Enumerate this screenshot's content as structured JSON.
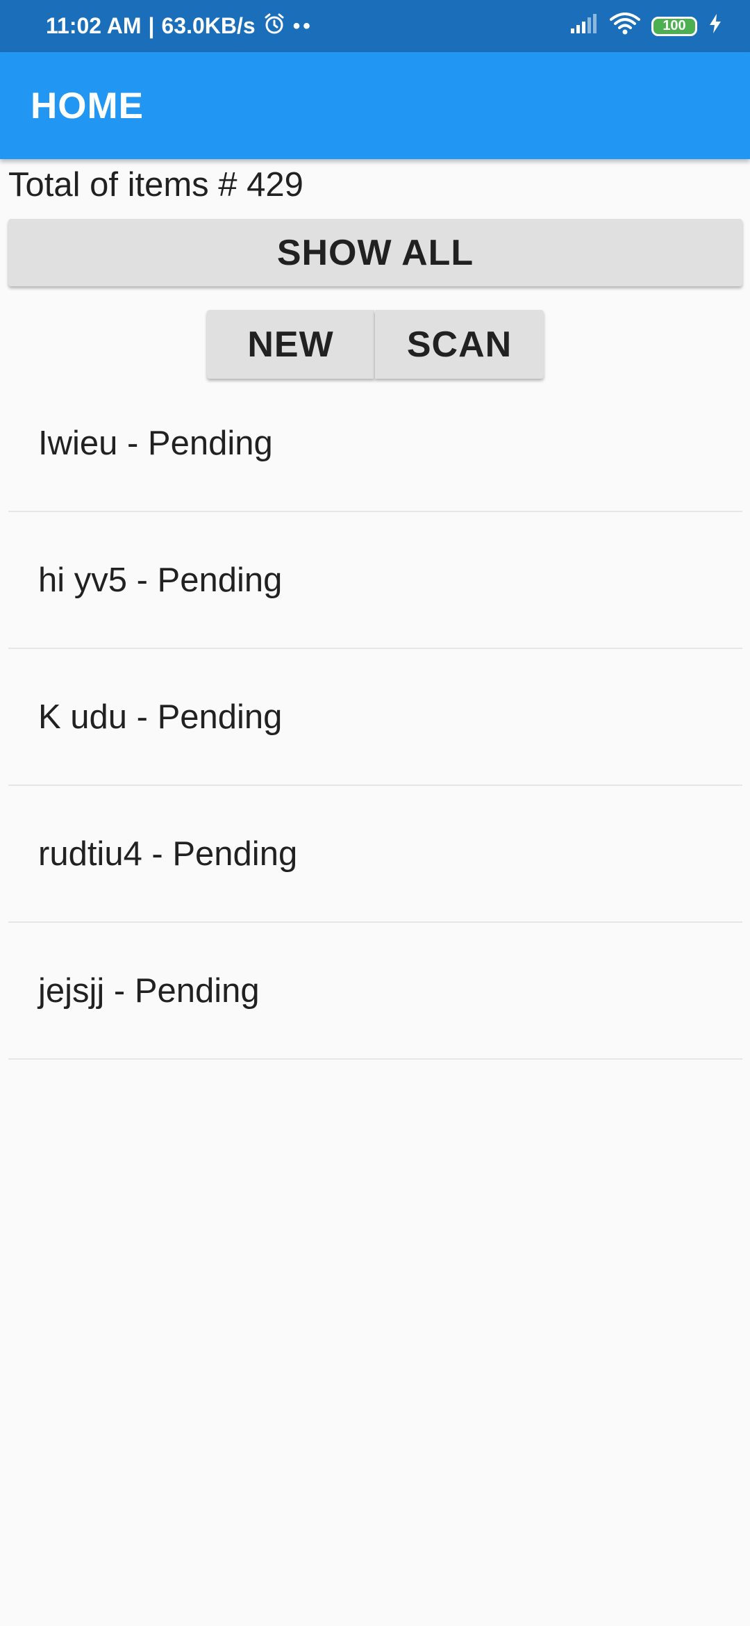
{
  "status_bar": {
    "time": "11:02 AM",
    "separator": "|",
    "network_speed": "63.0KB/s",
    "alarm_icon": "alarm-icon",
    "more_dots": "••",
    "signal_icon": "signal-icon",
    "wifi_icon": "wifi-icon",
    "battery_level": "100",
    "charging_icon": "charging-icon",
    "background_color": "#1b6fba"
  },
  "app_bar": {
    "title": "HOME",
    "background_color": "#2196f3"
  },
  "summary": {
    "total_label": "Total of items # 429"
  },
  "actions": {
    "show_all_label": "SHOW ALL",
    "new_label": "NEW",
    "scan_label": "SCAN"
  },
  "items": [
    {
      "label": "Iwieu - Pending"
    },
    {
      "label": "hi yv5 - Pending"
    },
    {
      "label": "K udu - Pending"
    },
    {
      "label": "rudtiu4 - Pending"
    },
    {
      "label": "jejsjj - Pending"
    }
  ]
}
